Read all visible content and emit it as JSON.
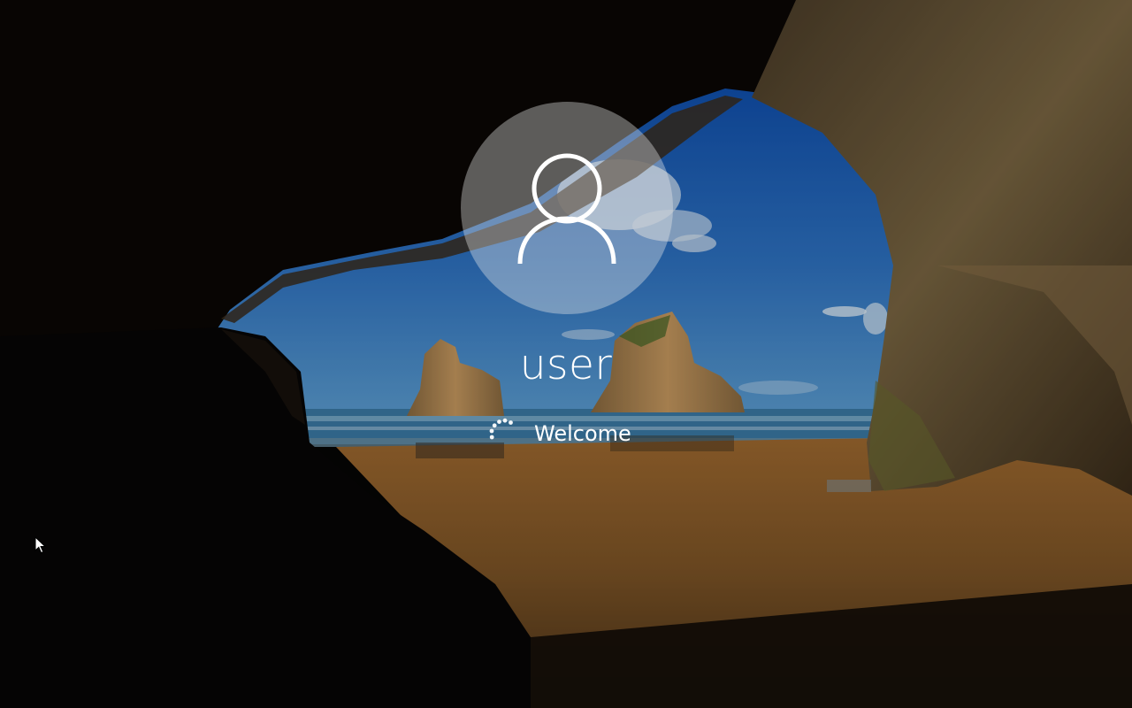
{
  "lock_screen": {
    "username": "user",
    "status_text": "Welcome",
    "avatar_icon": "user-silhouette-icon",
    "spinner_icon": "loading-spinner-icon",
    "pointer_icon": "mouse-pointer-icon"
  },
  "colors": {
    "text": "#ffffff",
    "sky": "#2f6fc0",
    "sea": "#3f7fa8",
    "sand": "#8a5e2c",
    "rock": "#6b5a3a",
    "cave": "#0a0806"
  }
}
